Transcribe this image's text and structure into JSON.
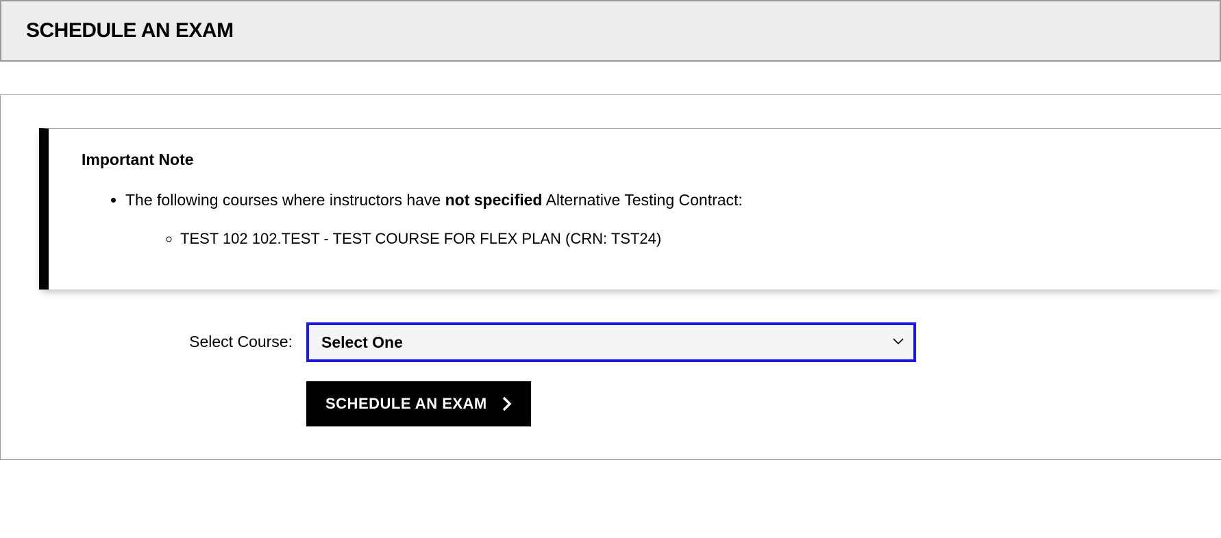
{
  "header": {
    "title": "SCHEDULE AN EXAM"
  },
  "note": {
    "title": "Important Note",
    "item_prefix": "The following courses where instructors have ",
    "item_bold": "not specified",
    "item_suffix": " Alternative Testing Contract:",
    "courses": [
      "TEST 102 102.TEST - TEST COURSE FOR FLEX PLAN (CRN: TST24)"
    ]
  },
  "form": {
    "select_course_label": "Select Course:",
    "select_placeholder": "Select One",
    "schedule_button_label": "SCHEDULE AN EXAM"
  }
}
